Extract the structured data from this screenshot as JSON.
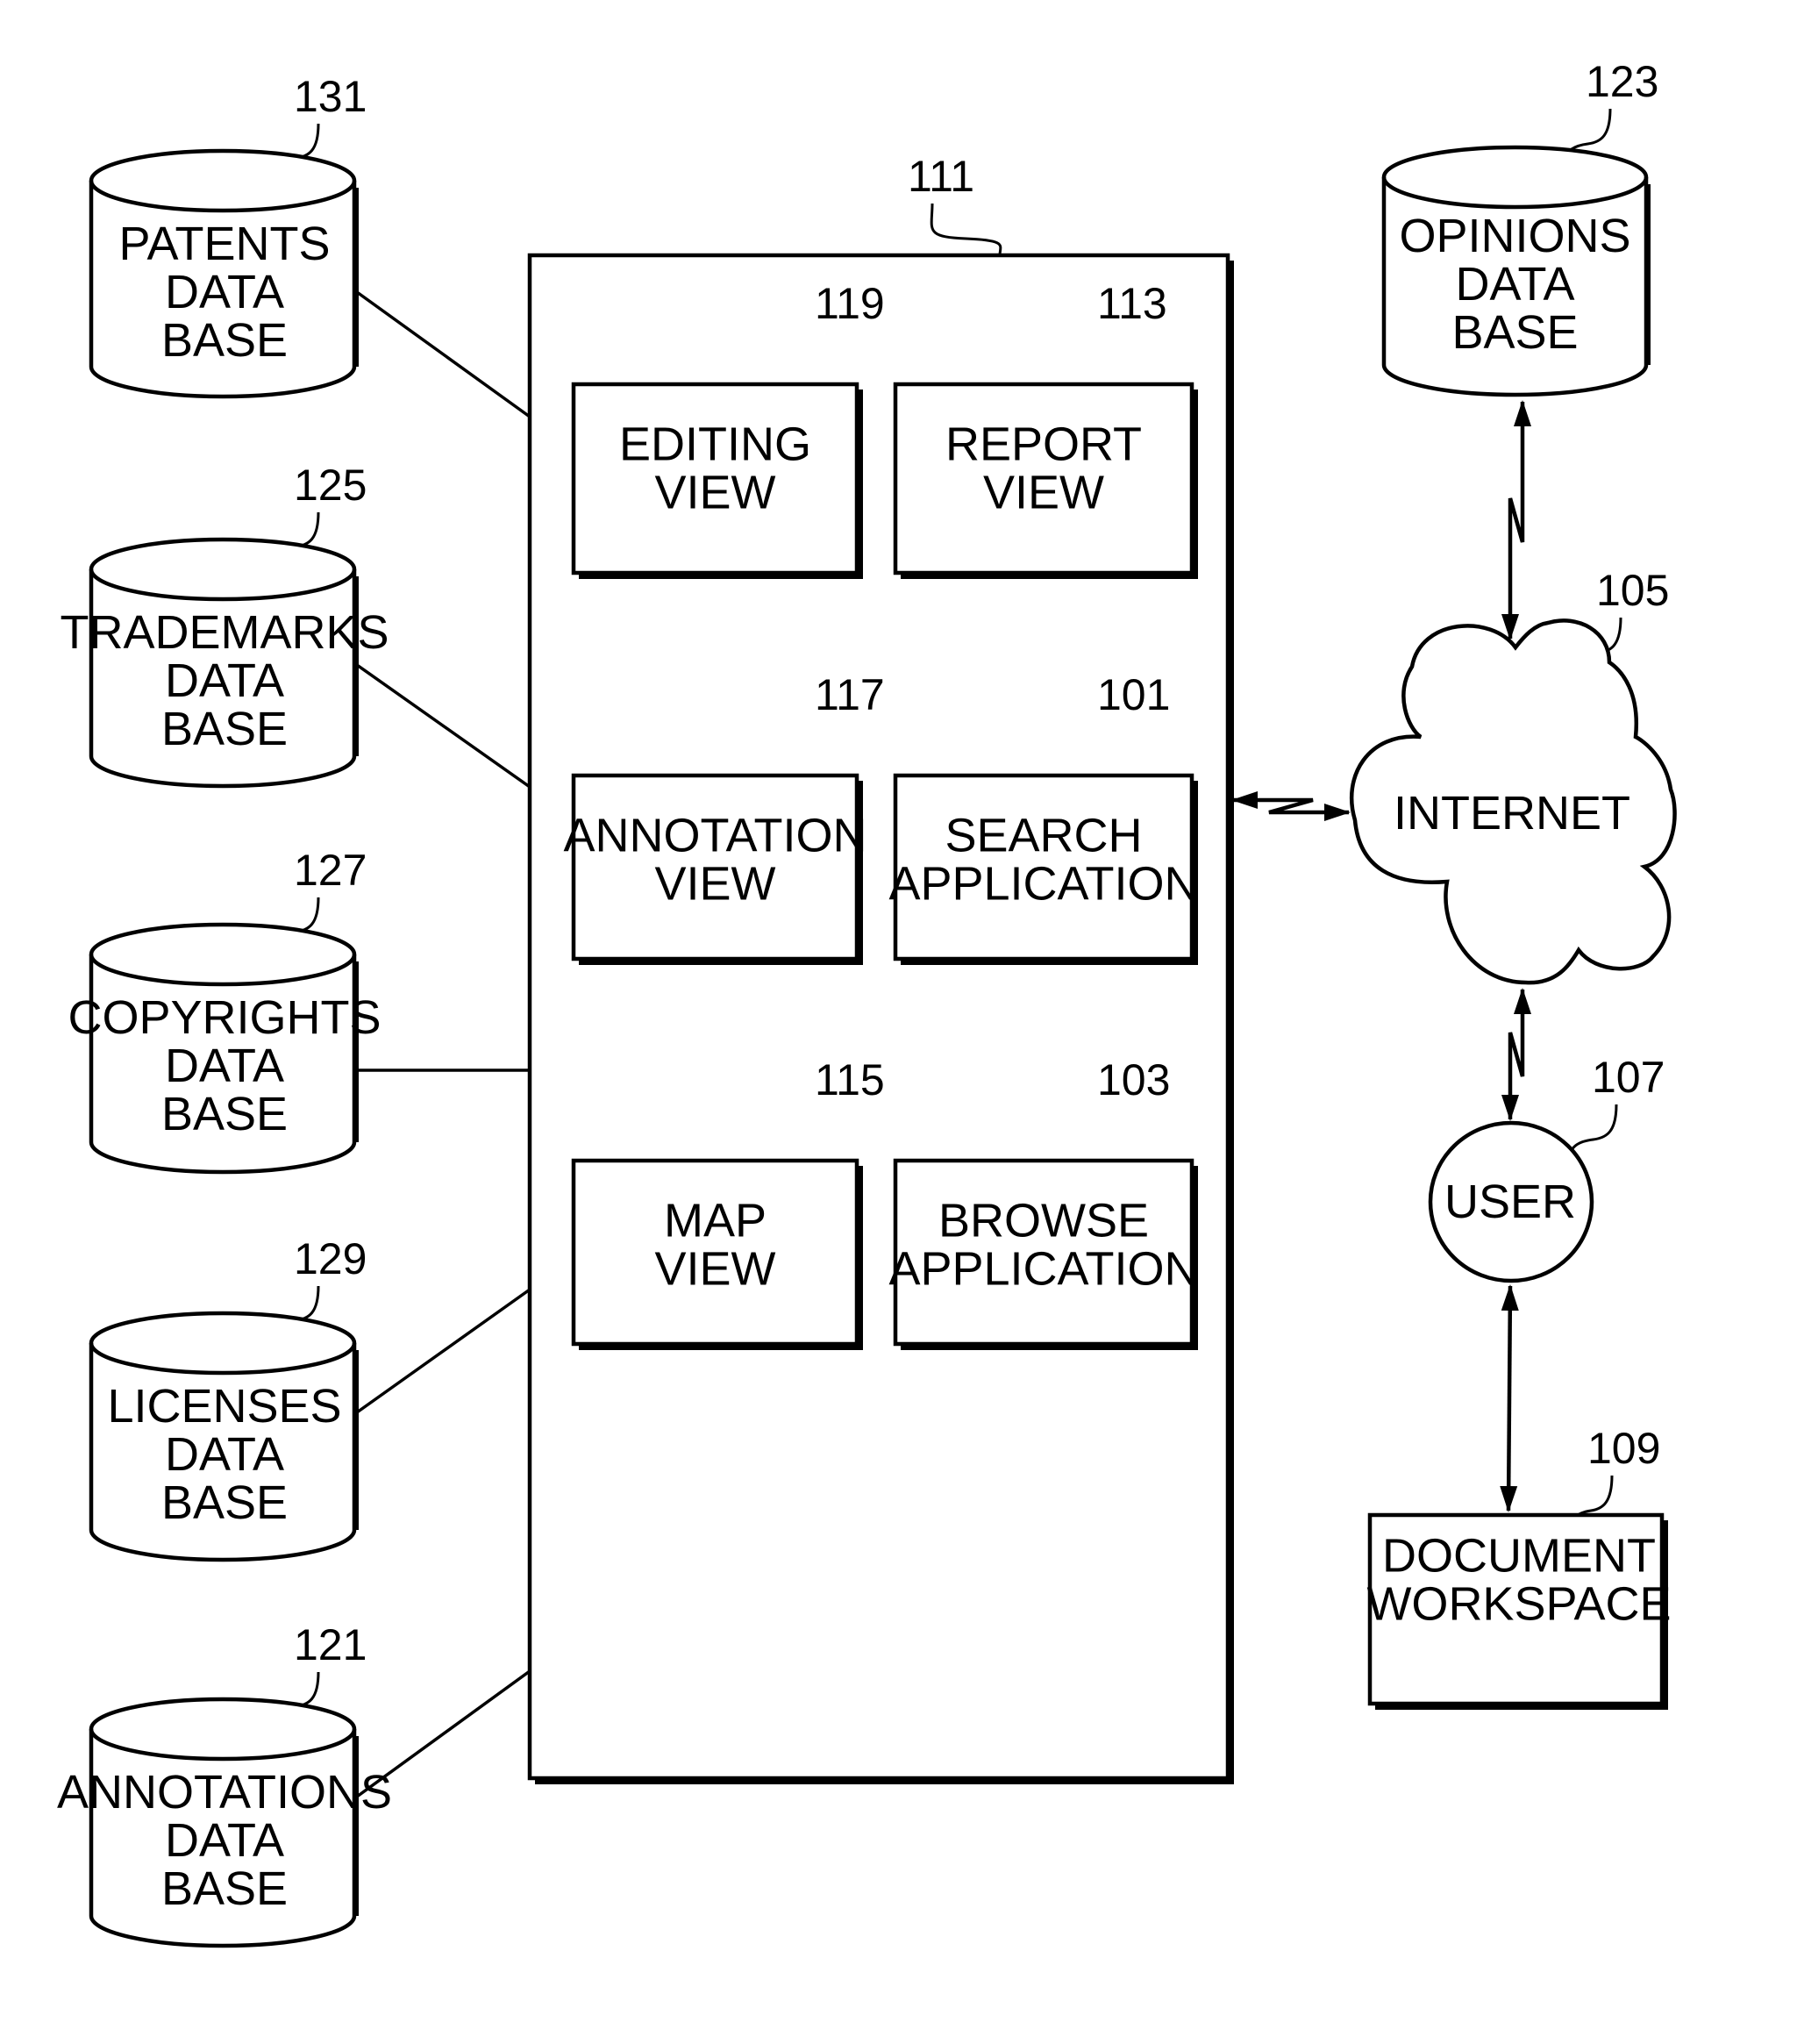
{
  "figure": {
    "main_system": {
      "ref": "111"
    },
    "modules": [
      {
        "id": "editing-view",
        "ref": "119",
        "lines": [
          "EDITING",
          "VIEW"
        ]
      },
      {
        "id": "report-view",
        "ref": "113",
        "lines": [
          "REPORT",
          "VIEW"
        ]
      },
      {
        "id": "annotation-view",
        "ref": "117",
        "lines": [
          "ANNOTATION",
          "VIEW"
        ]
      },
      {
        "id": "search-application",
        "ref": "101",
        "lines": [
          "SEARCH",
          "APPLICATION"
        ]
      },
      {
        "id": "map-view",
        "ref": "115",
        "lines": [
          "MAP",
          "VIEW"
        ]
      },
      {
        "id": "browse-application",
        "ref": "103",
        "lines": [
          "BROWSE",
          "APPLICATION"
        ]
      }
    ],
    "databases_left": [
      {
        "id": "patents-database",
        "ref": "131",
        "lines": [
          "PATENTS",
          "DATA",
          "BASE"
        ]
      },
      {
        "id": "trademarks-database",
        "ref": "125",
        "lines": [
          "TRADEMARKS",
          "DATA",
          "BASE"
        ]
      },
      {
        "id": "copyrights-database",
        "ref": "127",
        "lines": [
          "COPYRIGHTS",
          "DATA",
          "BASE"
        ]
      },
      {
        "id": "licenses-database",
        "ref": "129",
        "lines": [
          "LICENSES",
          "DATA",
          "BASE"
        ]
      },
      {
        "id": "annotations-database",
        "ref": "121",
        "lines": [
          "ANNOTATIONS",
          "DATA",
          "BASE"
        ]
      }
    ],
    "opinions_database": {
      "ref": "123",
      "lines": [
        "OPINIONS",
        "DATA",
        "BASE"
      ]
    },
    "internet": {
      "ref": "105",
      "label": "INTERNET"
    },
    "user": {
      "ref": "107",
      "label": "USER"
    },
    "document_workspace": {
      "ref": "109",
      "lines": [
        "DOCUMENT",
        "WORKSPACE"
      ]
    },
    "connections": [
      {
        "from": "patents-database",
        "to": "main-system",
        "type": "line"
      },
      {
        "from": "trademarks-database",
        "to": "main-system",
        "type": "line"
      },
      {
        "from": "copyrights-database",
        "to": "main-system",
        "type": "line"
      },
      {
        "from": "licenses-database",
        "to": "main-system",
        "type": "line"
      },
      {
        "from": "annotations-database",
        "to": "main-system",
        "type": "line"
      },
      {
        "from": "main-system",
        "to": "internet",
        "type": "network-link-bidirectional"
      },
      {
        "from": "opinions-database",
        "to": "internet",
        "type": "network-link-bidirectional"
      },
      {
        "from": "internet",
        "to": "user",
        "type": "network-link-bidirectional"
      },
      {
        "from": "user",
        "to": "document-workspace",
        "type": "bidirectional"
      }
    ]
  }
}
